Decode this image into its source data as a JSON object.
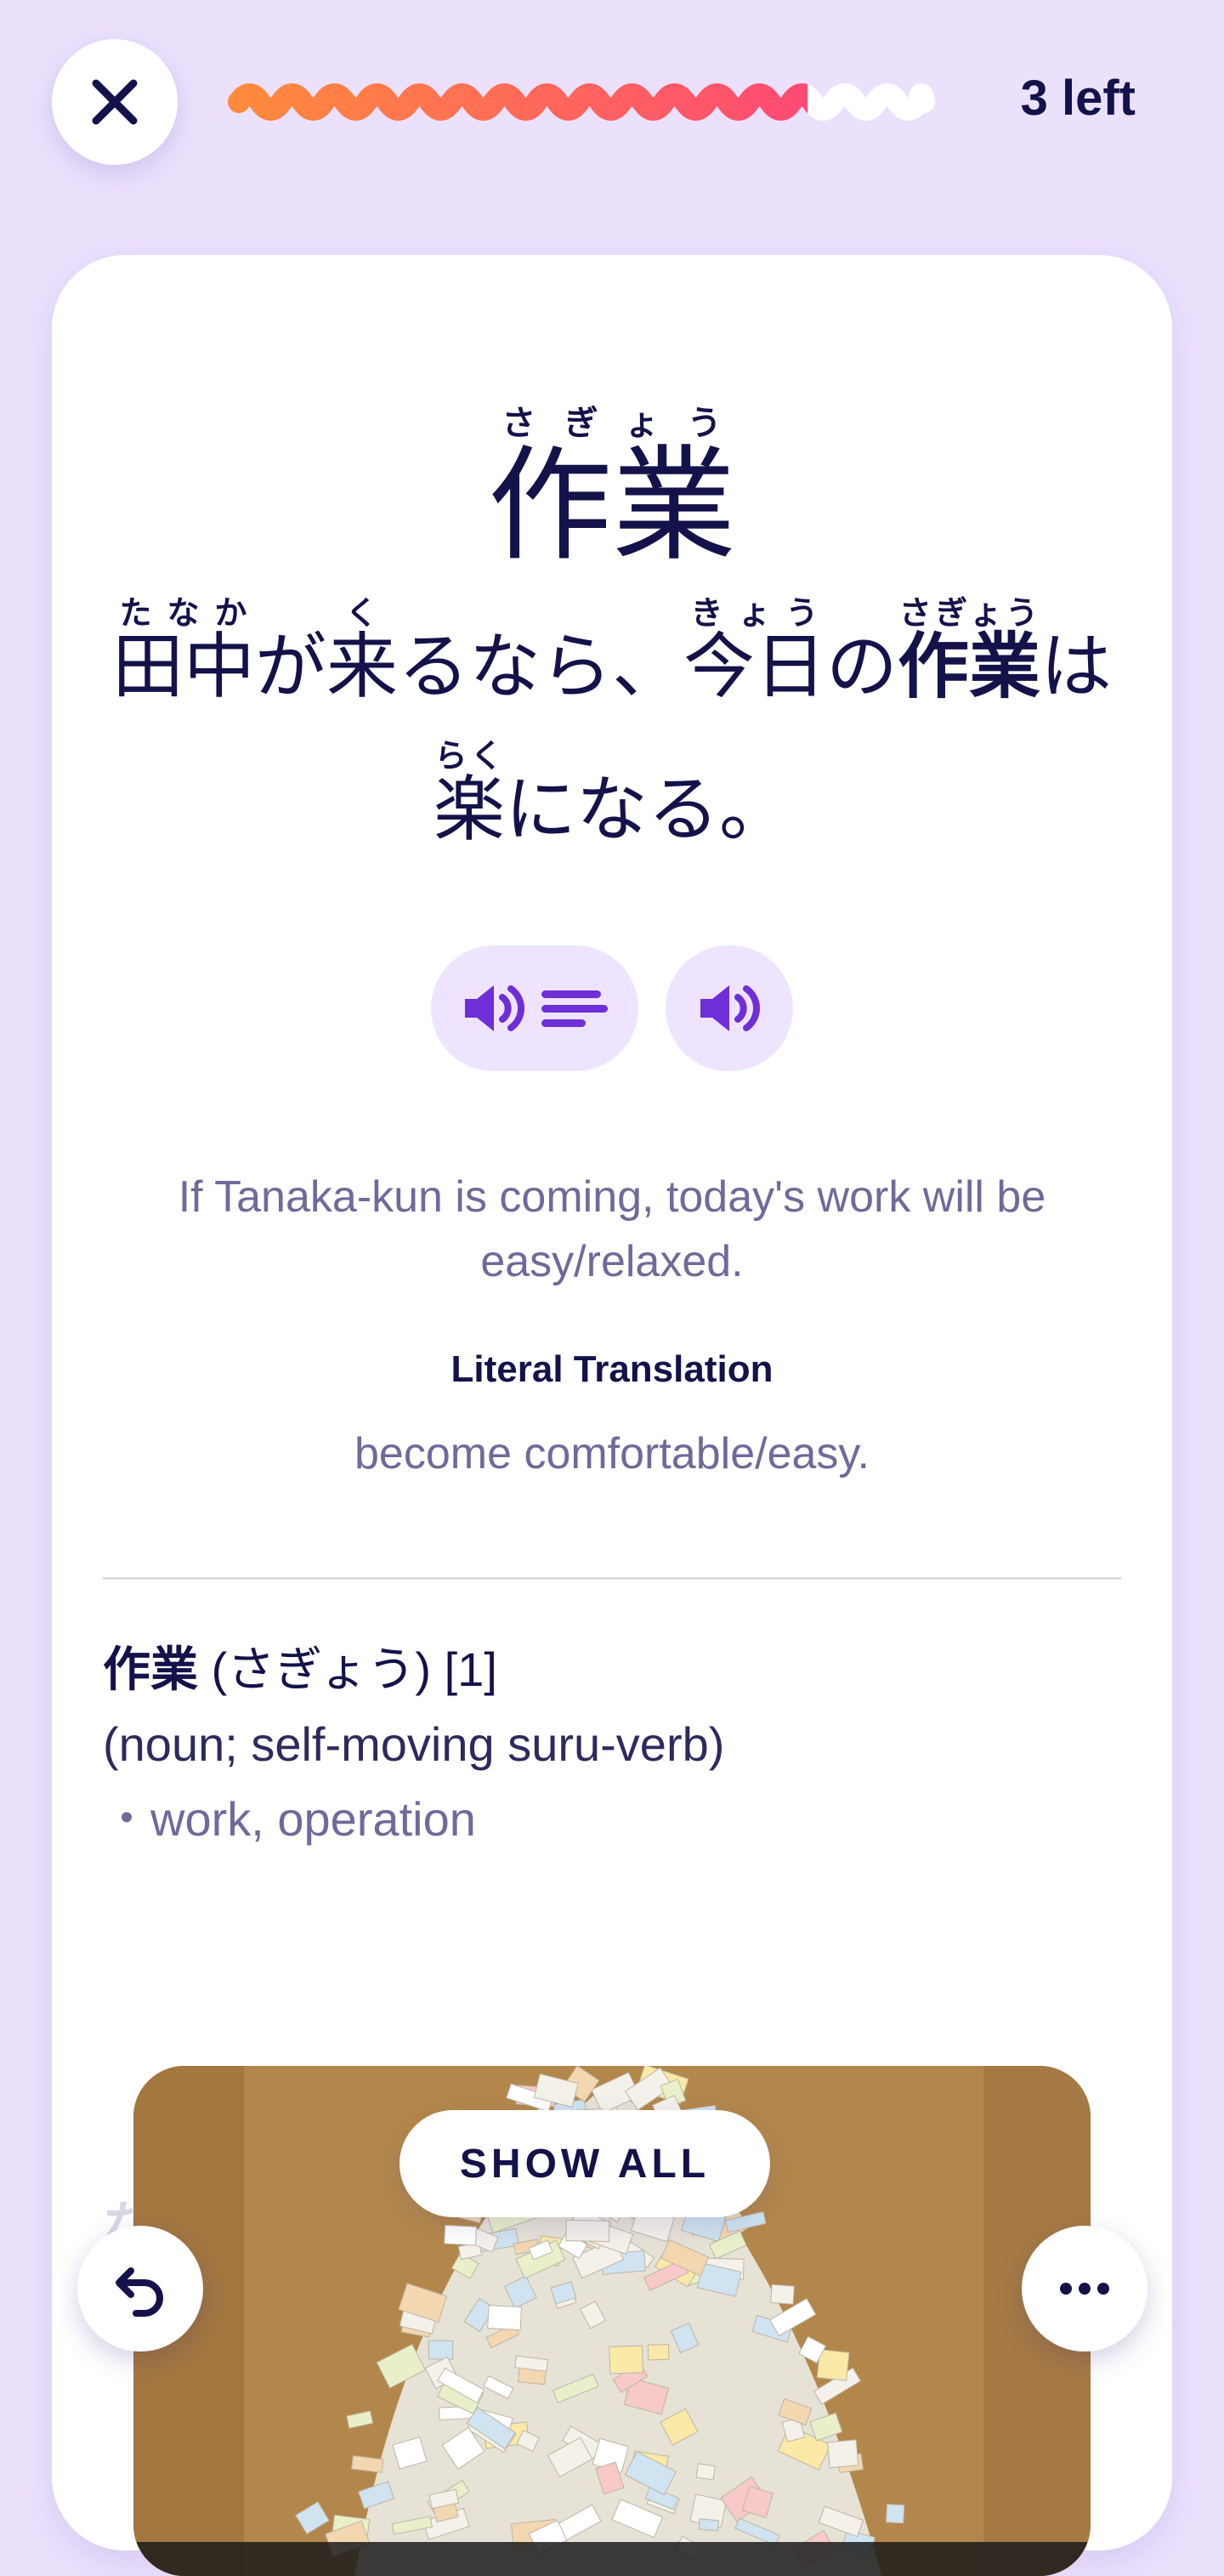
{
  "header": {
    "close_icon": "close-icon",
    "progress_fraction": 0.82,
    "remaining": "3 left"
  },
  "card": {
    "word": {
      "kanji": "作業",
      "reading": "さぎょう"
    },
    "sentence": {
      "segments": [
        {
          "base": "田中",
          "reading": "たなか"
        },
        {
          "text": "が"
        },
        {
          "base": "来",
          "reading": "く"
        },
        {
          "text": "るなら、"
        },
        {
          "base": "今日",
          "reading": "きょう"
        },
        {
          "text": "の"
        },
        {
          "base": "作業",
          "reading": "さぎょう",
          "bold": true
        },
        {
          "text": "は"
        },
        {
          "base": "楽",
          "reading": "らく"
        },
        {
          "text": "になる。"
        }
      ]
    },
    "audio": {
      "slow_icon": "speaker-slow-icon",
      "normal_icon": "speaker-icon"
    },
    "translation": "If Tanaka-kun is coming, today's work will be easy/relaxed.",
    "literal": {
      "heading": "Literal Translation",
      "text": "become comfortable/easy."
    },
    "definition": {
      "term": "作業",
      "reading_and_count": "(さぎょう) [1]",
      "pos": "(noun; self-moving suru-verb)",
      "gloss": "・work, operation"
    },
    "next_entry_preview": "なる [1]",
    "show_all_label": "SHOW ALL"
  },
  "footer": {
    "undo_icon": "undo-icon",
    "more_icon": "more-icon"
  },
  "colors": {
    "background": "#ebe1fd",
    "accent_purple": "#6e2ed8",
    "progress_gradient_start": "#ff8a3d",
    "progress_gradient_end": "#ff3d7f",
    "text_dark": "#14124a",
    "text_muted": "#6f6a9a"
  }
}
